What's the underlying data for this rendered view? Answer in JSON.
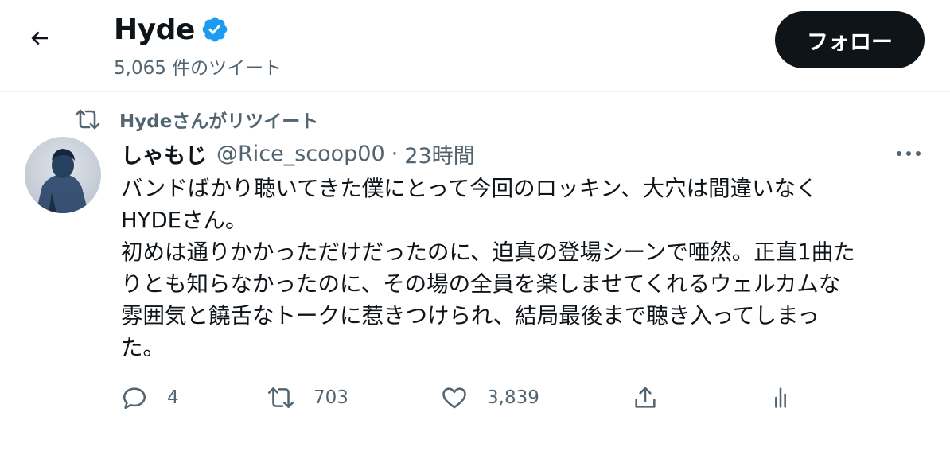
{
  "header": {
    "title": "Hyde",
    "subtitle": "5,065 件のツイート",
    "follow_label": "フォロー"
  },
  "retweet_banner": {
    "label": "Hydeさんがリツイート"
  },
  "tweet": {
    "author_name": "しゃもじ",
    "author_handle": "@Rice_scoop00",
    "separator": "·",
    "time": "23時間",
    "text_lines": [
      "バンドばかり聴いてきた僕にとって今回のロッキン、大穴は間違いなく",
      "HYDEさん。",
      "初めは通りかかっただけだったのに、迫真の登場シーンで唖然。正直1曲た",
      "りとも知らなかったのに、その場の全員を楽しませてくれるウェルカムな",
      "雰囲気と饒舌なトークに惹きつけられ、結局最後まで聴き入ってしまっ",
      "た。"
    ]
  },
  "actions": {
    "reply_count": "4",
    "retweet_count": "703",
    "like_count": "3,839"
  },
  "icons": {
    "back": "arrow-left-icon",
    "verified": "verified-badge-icon",
    "retweet": "retweet-icon",
    "more": "more-icon",
    "reply": "reply-icon",
    "like": "heart-icon",
    "share": "share-icon",
    "analytics": "analytics-icon"
  },
  "colors": {
    "text": "#0f1419",
    "muted": "#536471",
    "verified": "#1d9bf0",
    "button_bg": "#0f1419"
  }
}
